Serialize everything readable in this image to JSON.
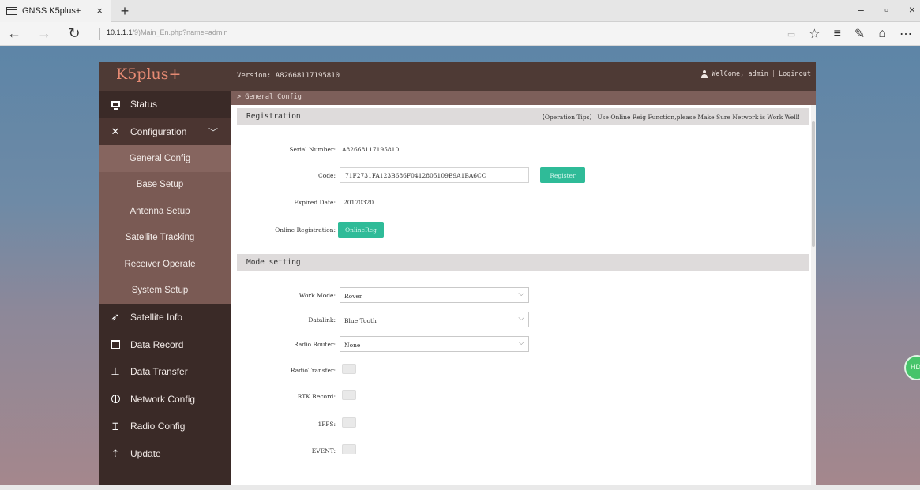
{
  "browser": {
    "tab_title": "GNSS K5plus+",
    "tab_close": "×",
    "new_tab": "+",
    "url_host": "10.1.1.1",
    "url_path": "/9)Main_En.php?name=admin",
    "win_min": "–",
    "win_max": "▫",
    "win_close": "×",
    "nav_back": "←",
    "nav_forward": "→",
    "nav_refresh": "↻",
    "addr_icons": {
      "favorite": "☆",
      "hub": "≡",
      "notes": "✎",
      "share": "⌂",
      "more": "⋯"
    }
  },
  "header": {
    "brand": "K5plus+",
    "version": "Version: A82668117195810",
    "welcome": "WelCome, admin",
    "separator": "|",
    "logout": "Loginout"
  },
  "sidebar": {
    "items": [
      {
        "label": "Status",
        "icon": "monitor-icon"
      },
      {
        "label": "Configuration",
        "icon": "tools-icon",
        "expanded": true
      },
      {
        "label": "Satellite Info",
        "icon": "satellite-icon"
      },
      {
        "label": "Data Record",
        "icon": "calendar-icon"
      },
      {
        "label": "Data Transfer",
        "icon": "transfer-icon"
      },
      {
        "label": "Network Config",
        "icon": "network-icon"
      },
      {
        "label": "Radio Config",
        "icon": "radio-icon"
      },
      {
        "label": "Update",
        "icon": "upload-icon"
      }
    ],
    "sub_items": [
      {
        "label": "General Config",
        "current": true
      },
      {
        "label": "Base Setup"
      },
      {
        "label": "Antenna Setup"
      },
      {
        "label": "Satellite Tracking"
      },
      {
        "label": "Receiver Operate"
      },
      {
        "label": "System Setup"
      }
    ],
    "chevron": "﹀"
  },
  "main": {
    "breadcrumb": "> General Config",
    "registration": {
      "title": "Registration",
      "tip": "【Operation Tips】 Use Online Reig Function,please Make Sure Network is Work Well!",
      "serial_label": "Serial Number:",
      "serial_value": "A82668117195810",
      "code_label": "Code:",
      "code_value": "71F2731FA123B686F0412805109B9A1BA6CC",
      "register_button": "Register",
      "expired_label": "Expired Date:",
      "expired_value": "20170320",
      "online_label": "Online Registration:",
      "online_button": "OnlineReg"
    },
    "mode": {
      "title": "Mode setting",
      "work_mode_label": "Work Mode:",
      "work_mode_value": "Rover",
      "datalink_label": "Datalink:",
      "datalink_value": "Blue Tooth",
      "radio_router_label": "Radio Router:",
      "radio_router_value": "None",
      "radio_transfer_label": "RadioTransfer:",
      "rtk_record_label": "RTK Record:",
      "pps_label": "1PPS:",
      "event_label": "EVENT:"
    },
    "dropdown_arrow": "⌵"
  },
  "floating_button": "HD"
}
